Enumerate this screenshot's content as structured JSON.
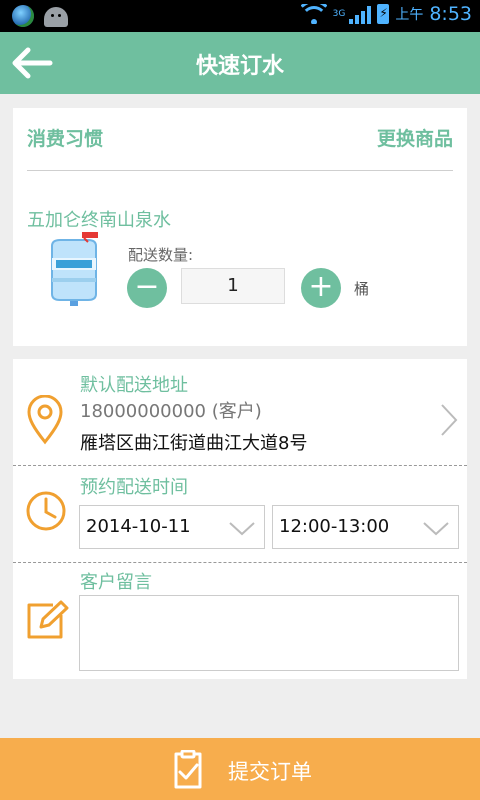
{
  "status_bar": {
    "ampm": "上午",
    "time": "8:53",
    "network": "3G"
  },
  "header": {
    "title": "快速订水"
  },
  "product_card": {
    "habit_label": "消费习惯",
    "change_label": "更换商品",
    "product_name": "五加仑终南山泉水",
    "quantity_label": "配送数量:",
    "minus": "−",
    "plus": "+",
    "quantity": "1",
    "unit": "桶"
  },
  "address_section": {
    "label": "默认配送地址",
    "phone": "18000000000 (客户)",
    "address": "雁塔区曲江街道曲江大道8号"
  },
  "time_section": {
    "label": "预约配送时间",
    "date": "2014-10-11",
    "slot": "12:00-13:00"
  },
  "note_section": {
    "label": "客户留言",
    "value": ""
  },
  "footer": {
    "submit_label": "提交订单"
  },
  "colors": {
    "accent": "#6fbf9f",
    "button": "#f7ad4d",
    "icon": "#f0a030"
  }
}
